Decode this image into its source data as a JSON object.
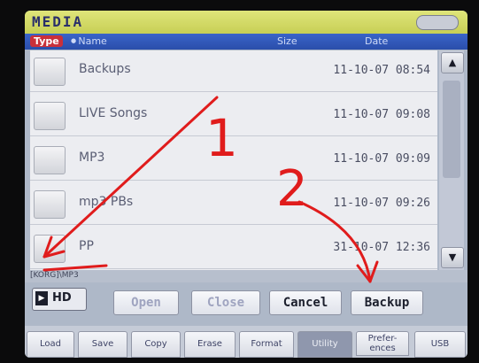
{
  "window": {
    "title": "MEDIA"
  },
  "columns": {
    "type": "Type",
    "name": "Name",
    "size": "Size",
    "date": "Date"
  },
  "files": [
    {
      "name": "Backups",
      "date": "11-10-07 08:54"
    },
    {
      "name": "LIVE Songs",
      "date": "11-10-07 09:08"
    },
    {
      "name": "MP3",
      "date": "11-10-07 09:09"
    },
    {
      "name": "mp3 PBs",
      "date": "11-10-07 09:26"
    },
    {
      "name": "PP",
      "date": "31-10-07 12:36"
    }
  ],
  "path": "[KORG]\\MP3",
  "device": {
    "label": "HD"
  },
  "actions": {
    "open": "Open",
    "close": "Close",
    "cancel": "Cancel",
    "backup": "Backup"
  },
  "tabs": [
    "Load",
    "Save",
    "Copy",
    "Erase",
    "Format",
    "Utility",
    "Prefer-\nences",
    "USB"
  ],
  "selected_tab": "Utility",
  "annotations": {
    "one": "1",
    "two": "2"
  },
  "colors": {
    "title_bar": "#c7cf55",
    "header": "#2a4eaa",
    "type_badge": "#c9303a",
    "annotation": "#e01c1c"
  }
}
